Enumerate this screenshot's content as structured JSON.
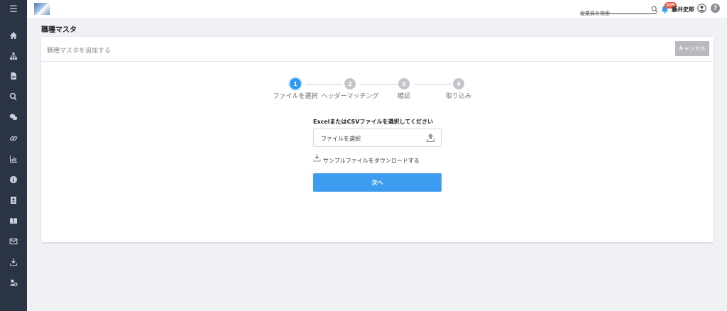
{
  "sidebar": {
    "menu_icon": "hamburger-icon",
    "items": [
      {
        "icon": "home-icon"
      },
      {
        "icon": "org-chart-icon"
      },
      {
        "icon": "document-icon"
      },
      {
        "icon": "search-icon"
      },
      {
        "icon": "chat-icon"
      },
      {
        "icon": "link-icon"
      },
      {
        "icon": "chart-icon"
      },
      {
        "icon": "info-icon"
      },
      {
        "icon": "contact-book-icon"
      },
      {
        "icon": "book-icon"
      },
      {
        "icon": "mail-icon"
      },
      {
        "icon": "download-icon"
      },
      {
        "icon": "user-settings-icon"
      }
    ]
  },
  "topbar": {
    "search_placeholder": "従業員を検索",
    "notification_count": "205",
    "username": "藤井史郎"
  },
  "page": {
    "title": "職種マスタ"
  },
  "card": {
    "title": "職種マスタを追加する",
    "cancel_label": "キャンセル"
  },
  "stepper": {
    "steps": [
      {
        "number": "1",
        "label": "ファイルを選択",
        "active": true
      },
      {
        "number": "2",
        "label": "ヘッダーマッチング",
        "active": false
      },
      {
        "number": "3",
        "label": "確認",
        "active": false
      },
      {
        "number": "4",
        "label": "取り込み",
        "active": false
      }
    ]
  },
  "form": {
    "label": "ExcelまたはCSVファイルを選択してください",
    "file_placeholder": "ファイルを選択",
    "download_link": "サンプルファイルをダウンロードする",
    "next_label": "次へ"
  },
  "colors": {
    "sidebar": "#2b3445",
    "accent": "#3d9bf0",
    "badge": "#e5533d",
    "cancel": "#b7b9be"
  }
}
